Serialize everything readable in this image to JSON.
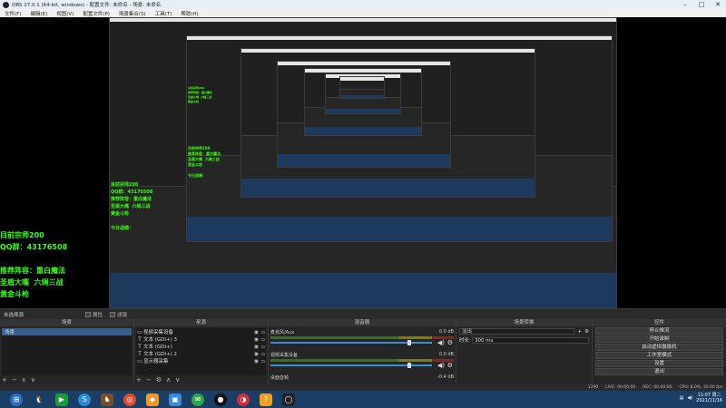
{
  "window": {
    "title": "OBS 27.0.1 (64-bit, windows) - 配置文件: 未命名 - 场景: 未命名",
    "controls": [
      "–",
      "□",
      "✕"
    ]
  },
  "menu": [
    "文件(F)",
    "编辑(E)",
    "视图(V)",
    "配置文件(P)",
    "场景集合(S)",
    "工具(T)",
    "帮助(H)"
  ],
  "overlay": {
    "line1": "目前宗师200",
    "line2": "QQ群：43176508",
    "line3": "推荐阵容：重白魔法",
    "line4": "圣盾大嘴  六绳三战",
    "line5": "黄金斗枪",
    "line6": "今日战绩："
  },
  "midbar": {
    "scene_label": "未选择源",
    "properties": "属性",
    "filters": "滤镜"
  },
  "scenes": {
    "title": "场景",
    "items": [
      "场景"
    ]
  },
  "sources": {
    "title": "来源",
    "items": [
      {
        "icon": "▭",
        "label": "视频采集设备"
      },
      {
        "icon": "T",
        "label": "文本 (GDI+) 3"
      },
      {
        "icon": "T",
        "label": "文本 (GDI+)"
      },
      {
        "icon": "T",
        "label": "文本 (GDI+) 2"
      },
      {
        "icon": "▭",
        "label": "显示器采集"
      }
    ]
  },
  "mixer": {
    "title": "混音器",
    "channels": [
      {
        "name": "麦克风/Aux",
        "db": "0.0 dB",
        "level": 0.86
      },
      {
        "name": "视频采集设备",
        "db": "0.0 dB",
        "level": 0.86
      },
      {
        "name": "桌面音频",
        "db": "-0.4 dB",
        "level": 0.55
      }
    ]
  },
  "transitions": {
    "title": "场景转换",
    "type": "淡出",
    "duration_label": "时长",
    "duration": "300 ms"
  },
  "controls": {
    "title": "控件",
    "buttons": [
      "停止推流",
      "开始录制",
      "启动虚拟摄像机",
      "工作室模式",
      "设置",
      "退出"
    ]
  },
  "status": {
    "live": "LIVE: 00:00:00",
    "rec": "REC: 00:00:00",
    "cpu": "CPU: 8.0%, 30.00 fps",
    "dropped": "1290"
  },
  "taskbar": {
    "time": "11:07 周二",
    "date": "2021/11/16"
  },
  "colors": {
    "overlay_text": "#39ff14",
    "taskbar": "#1b3e66",
    "selection": "#3a5e8c"
  }
}
